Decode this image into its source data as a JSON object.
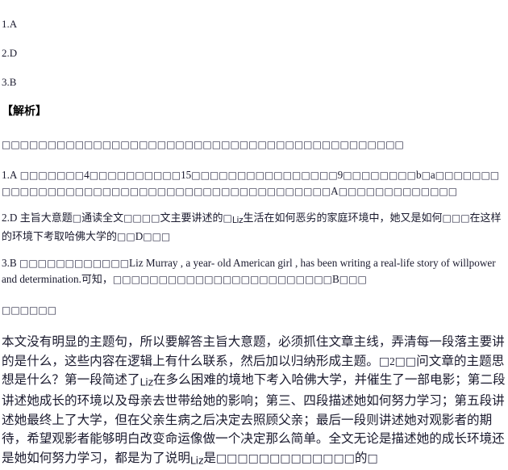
{
  "document": {
    "answers": [
      {
        "label": "1.A"
      },
      {
        "label": "2.D"
      },
      {
        "label": "3.B"
      }
    ],
    "analysis_heading": "【解析】",
    "intro_line": "□□□□□□□□□□□□□□□□□□□□□□□□□□□□□□□□□□□□□□□□□□□□",
    "explanations": [
      {
        "id": "explanation-1",
        "prefix": "1.A",
        "segments": [
          {
            "type": "tofu",
            "text": "□□□□□□□"
          },
          {
            "type": "latin",
            "text": "4"
          },
          {
            "type": "tofu",
            "text": "□□□□□□□□□□"
          },
          {
            "type": "latin",
            "text": "15"
          },
          {
            "type": "tofu",
            "text": "□□□□□□□□□□□□□□□□"
          },
          {
            "type": "latin",
            "text": "9"
          },
          {
            "type": "tofu",
            "text": "□□□□□□□□"
          },
          {
            "type": "latin",
            "text": "b"
          },
          {
            "type": "tofu",
            "text": "□"
          },
          {
            "type": "latin",
            "text": "a"
          },
          {
            "type": "tofu",
            "text": "□□□□□□□□□□□□□□□□□□□□□□□□□□□□□□□□□□□□□□□□□□□"
          },
          {
            "type": "latin",
            "text": "A"
          },
          {
            "type": "tofu",
            "text": "□□□□□□□□□□□□□"
          }
        ]
      },
      {
        "id": "explanation-2",
        "prefix": "2.D",
        "segments": [
          {
            "type": "cjk",
            "text": "主旨大意题"
          },
          {
            "type": "tofu",
            "text": "□"
          },
          {
            "type": "cjk",
            "text": "通读全文"
          },
          {
            "type": "tofu",
            "text": "□□□□"
          },
          {
            "type": "cjk",
            "text": "文主要讲述的"
          },
          {
            "type": "tofu",
            "text": "□"
          },
          {
            "type": "fallback",
            "text": "Liz"
          },
          {
            "type": "cjk",
            "text": "生活在如何恶劣的家庭环境中，她又是如何"
          },
          {
            "type": "tofu",
            "text": "□□□"
          },
          {
            "type": "cjk",
            "text": "在这样的环境下考取哈佛大学的"
          },
          {
            "type": "tofu",
            "text": "□□"
          },
          {
            "type": "latin",
            "text": "D"
          },
          {
            "type": "tofu",
            "text": "□□□"
          }
        ]
      },
      {
        "id": "explanation-3",
        "prefix": "3.B",
        "segments": [
          {
            "type": "tofu",
            "text": "□□□□□□□□□□□□"
          },
          {
            "type": "latin",
            "text": "Liz Murray , a year- old American girl , has been writing a real-life story of willpower and determination."
          },
          {
            "type": "cjk",
            "text": "可知，"
          },
          {
            "type": "tofu",
            "text": "□□□□□□□□□□□□□□□□□□□□□□□□"
          },
          {
            "type": "latin",
            "text": "B"
          },
          {
            "type": "tofu",
            "text": "□□□"
          }
        ]
      }
    ],
    "summary_marker": "□□□□□□",
    "summary": {
      "id": "summary-paragraph",
      "segments": [
        {
          "type": "cjk",
          "text": "本文没有明显的主题句，所以要解答主旨大意题，必须抓住文章主线，弄清每一段落主要讲的是什么，这些内容在逻辑上有什么联系，然后加以归纳形成主题。"
        },
        {
          "type": "tofu",
          "text": "□"
        },
        {
          "type": "latin",
          "text": "2"
        },
        {
          "type": "tofu",
          "text": "□□"
        },
        {
          "type": "cjk",
          "text": "问文章的主题思想是什么？第一段简述了"
        },
        {
          "type": "fallback",
          "text": "Liz"
        },
        {
          "type": "cjk",
          "text": "在多么困难的境地下考入哈佛大学，并催生了一部电影；第二段讲述她成长的环境以及母亲去世带给她的影响；第三、四段描述她如何努力学习；第五段讲述她最终上了大学，但在父亲生病之后决定去照顾父亲；最后一段则讲述她对观影者的期待，希望观影者能够明白改变命运像做一个决定那么简单。全文无论是描述她的成长环境还是她如何努力学习，都是为了说明"
        },
        {
          "type": "fallback",
          "text": "Liz"
        },
        {
          "type": "cjk",
          "text": "是"
        },
        {
          "type": "tofu",
          "text": "□□□□□□□□□□□□□"
        },
        {
          "type": "cjk",
          "text": "的"
        },
        {
          "type": "tofu",
          "text": "□"
        }
      ]
    }
  }
}
